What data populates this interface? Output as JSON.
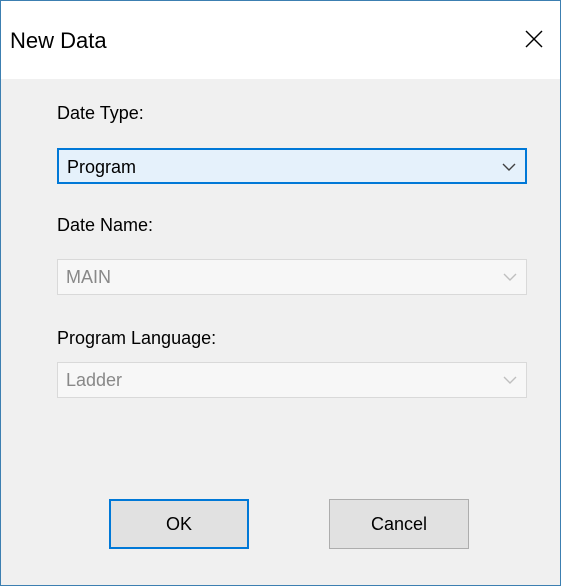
{
  "window": {
    "title": "New Data",
    "close_icon": "close-icon"
  },
  "form": {
    "data_type": {
      "label": "Date Type:",
      "value": "Program"
    },
    "data_name": {
      "label": "Date Name:",
      "value": "MAIN"
    },
    "program_language": {
      "label": "Program Language:",
      "value": "Ladder"
    }
  },
  "buttons": {
    "ok_label": "OK",
    "cancel_label": "Cancel"
  },
  "colors": {
    "accent": "#0078d7",
    "border": "#3c7fb1",
    "background": "#f0f0f0",
    "disabled_text": "#888888"
  }
}
